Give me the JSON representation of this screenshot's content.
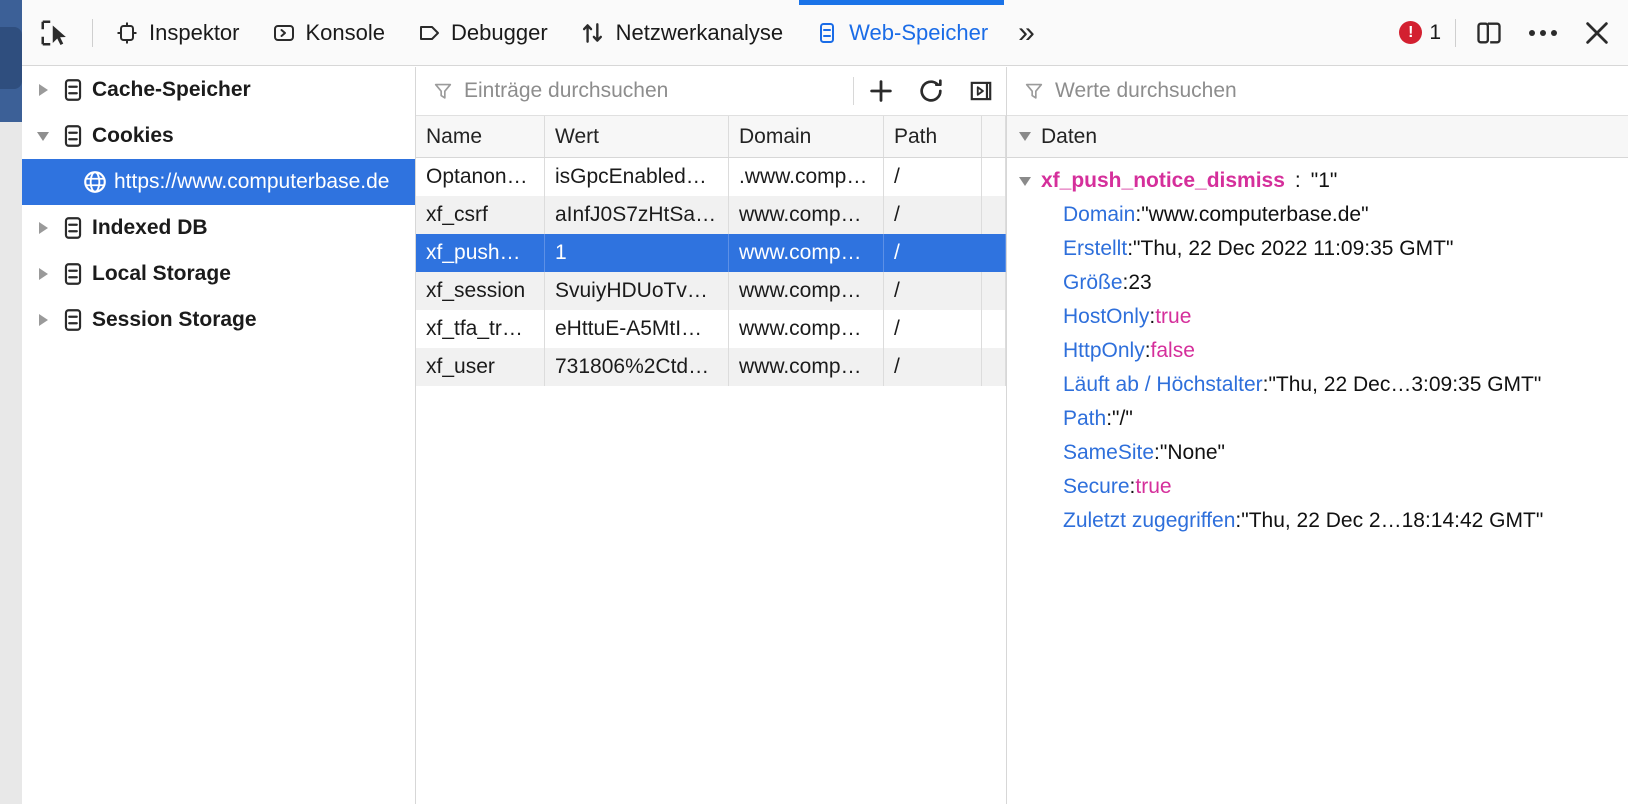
{
  "toolbar": {
    "picker_icon": "element-picker-icon",
    "tabs": [
      {
        "label": "Inspektor",
        "icon": "inspector-icon",
        "active": false
      },
      {
        "label": "Konsole",
        "icon": "console-icon",
        "active": false
      },
      {
        "label": "Debugger",
        "icon": "debugger-icon",
        "active": false
      },
      {
        "label": "Netzwerkanalyse",
        "icon": "network-icon",
        "active": false
      },
      {
        "label": "Web-Speicher",
        "icon": "storage-icon",
        "active": true
      }
    ],
    "overflow_label": "»",
    "error_count": "1",
    "error_icon": "error-circle-icon",
    "responsive_icon": "responsive-design-mode-icon",
    "menu_icon": "more-options-icon",
    "close_icon": "close-icon",
    "accent_color": "#1a73e8",
    "error_color": "#d32030"
  },
  "sidebar": {
    "items": [
      {
        "label": "Cache-Speicher",
        "expanded": false,
        "level": 0,
        "icon": "storage-item-icon"
      },
      {
        "label": "Cookies",
        "expanded": true,
        "level": 0,
        "icon": "storage-item-icon"
      },
      {
        "label": "https://www.computerbase.de",
        "expanded": null,
        "level": 1,
        "icon": "globe-icon",
        "selected": true
      },
      {
        "label": "Indexed DB",
        "expanded": false,
        "level": 0,
        "icon": "storage-item-icon"
      },
      {
        "label": "Local Storage",
        "expanded": false,
        "level": 0,
        "icon": "storage-item-icon"
      },
      {
        "label": "Session Storage",
        "expanded": false,
        "level": 0,
        "icon": "storage-item-icon"
      }
    ]
  },
  "table": {
    "filter_placeholder": "Einträge durchsuchen",
    "filter_value": "",
    "filter_icon": "funnel-icon",
    "buttons": [
      {
        "name": "add-item-button",
        "icon": "plus-icon"
      },
      {
        "name": "refresh-button",
        "icon": "refresh-icon"
      },
      {
        "name": "toggle-sidebar-button",
        "icon": "expand-panel-icon"
      }
    ],
    "columns": [
      "Name",
      "Wert",
      "Domain",
      "Path",
      ""
    ],
    "rows": [
      {
        "name": "Optanon…",
        "value": "isGpcEnabled…",
        "domain": ".www.comp…",
        "path": "/",
        "extra": "",
        "selected": false
      },
      {
        "name": "xf_csrf",
        "value": "aInfJ0S7zHtSa…",
        "domain": "www.comp…",
        "path": "/",
        "extra": "",
        "selected": false
      },
      {
        "name": "xf_push…",
        "value": "1",
        "domain": "www.comp…",
        "path": "/",
        "extra": "",
        "selected": true
      },
      {
        "name": "xf_session",
        "value": "SvuiyHDUoTv…",
        "domain": "www.comp…",
        "path": "/",
        "extra": "",
        "selected": false
      },
      {
        "name": "xf_tfa_tr…",
        "value": "eHttuE-A5MtI…",
        "domain": "www.comp…",
        "path": "/",
        "extra": "",
        "selected": false
      },
      {
        "name": "xf_user",
        "value": "731806%2Ctd…",
        "domain": "www.comp…",
        "path": "/",
        "extra": "",
        "selected": false
      }
    ]
  },
  "detail": {
    "filter_placeholder": "Werte durchsuchen",
    "filter_value": "",
    "filter_icon": "funnel-icon",
    "header_label": "Daten",
    "root": {
      "key": "xf_push_notice_dismiss",
      "value": "\"1\""
    },
    "properties": [
      {
        "key": "Domain",
        "value": "\"www.computerbase.de\"",
        "kind": "string"
      },
      {
        "key": "Erstellt",
        "value": "\"Thu, 22 Dec 2022 11:09:35 GMT\"",
        "kind": "string"
      },
      {
        "key": "Größe",
        "value": "23",
        "kind": "number"
      },
      {
        "key": "HostOnly",
        "value": "true",
        "kind": "bool"
      },
      {
        "key": "HttpOnly",
        "value": "false",
        "kind": "bool"
      },
      {
        "key": "Läuft ab / Höchstalter",
        "value": "\"Thu, 22 Dec…3:09:35 GMT\"",
        "kind": "string"
      },
      {
        "key": "Path",
        "value": "\"/\"",
        "kind": "string"
      },
      {
        "key": "SameSite",
        "value": "\"None\"",
        "kind": "string"
      },
      {
        "key": "Secure",
        "value": "true",
        "kind": "bool"
      },
      {
        "key": "Zuletzt zugegriffen",
        "value": "\"Thu, 22 Dec 2…18:14:42 GMT\"",
        "kind": "string"
      }
    ]
  }
}
